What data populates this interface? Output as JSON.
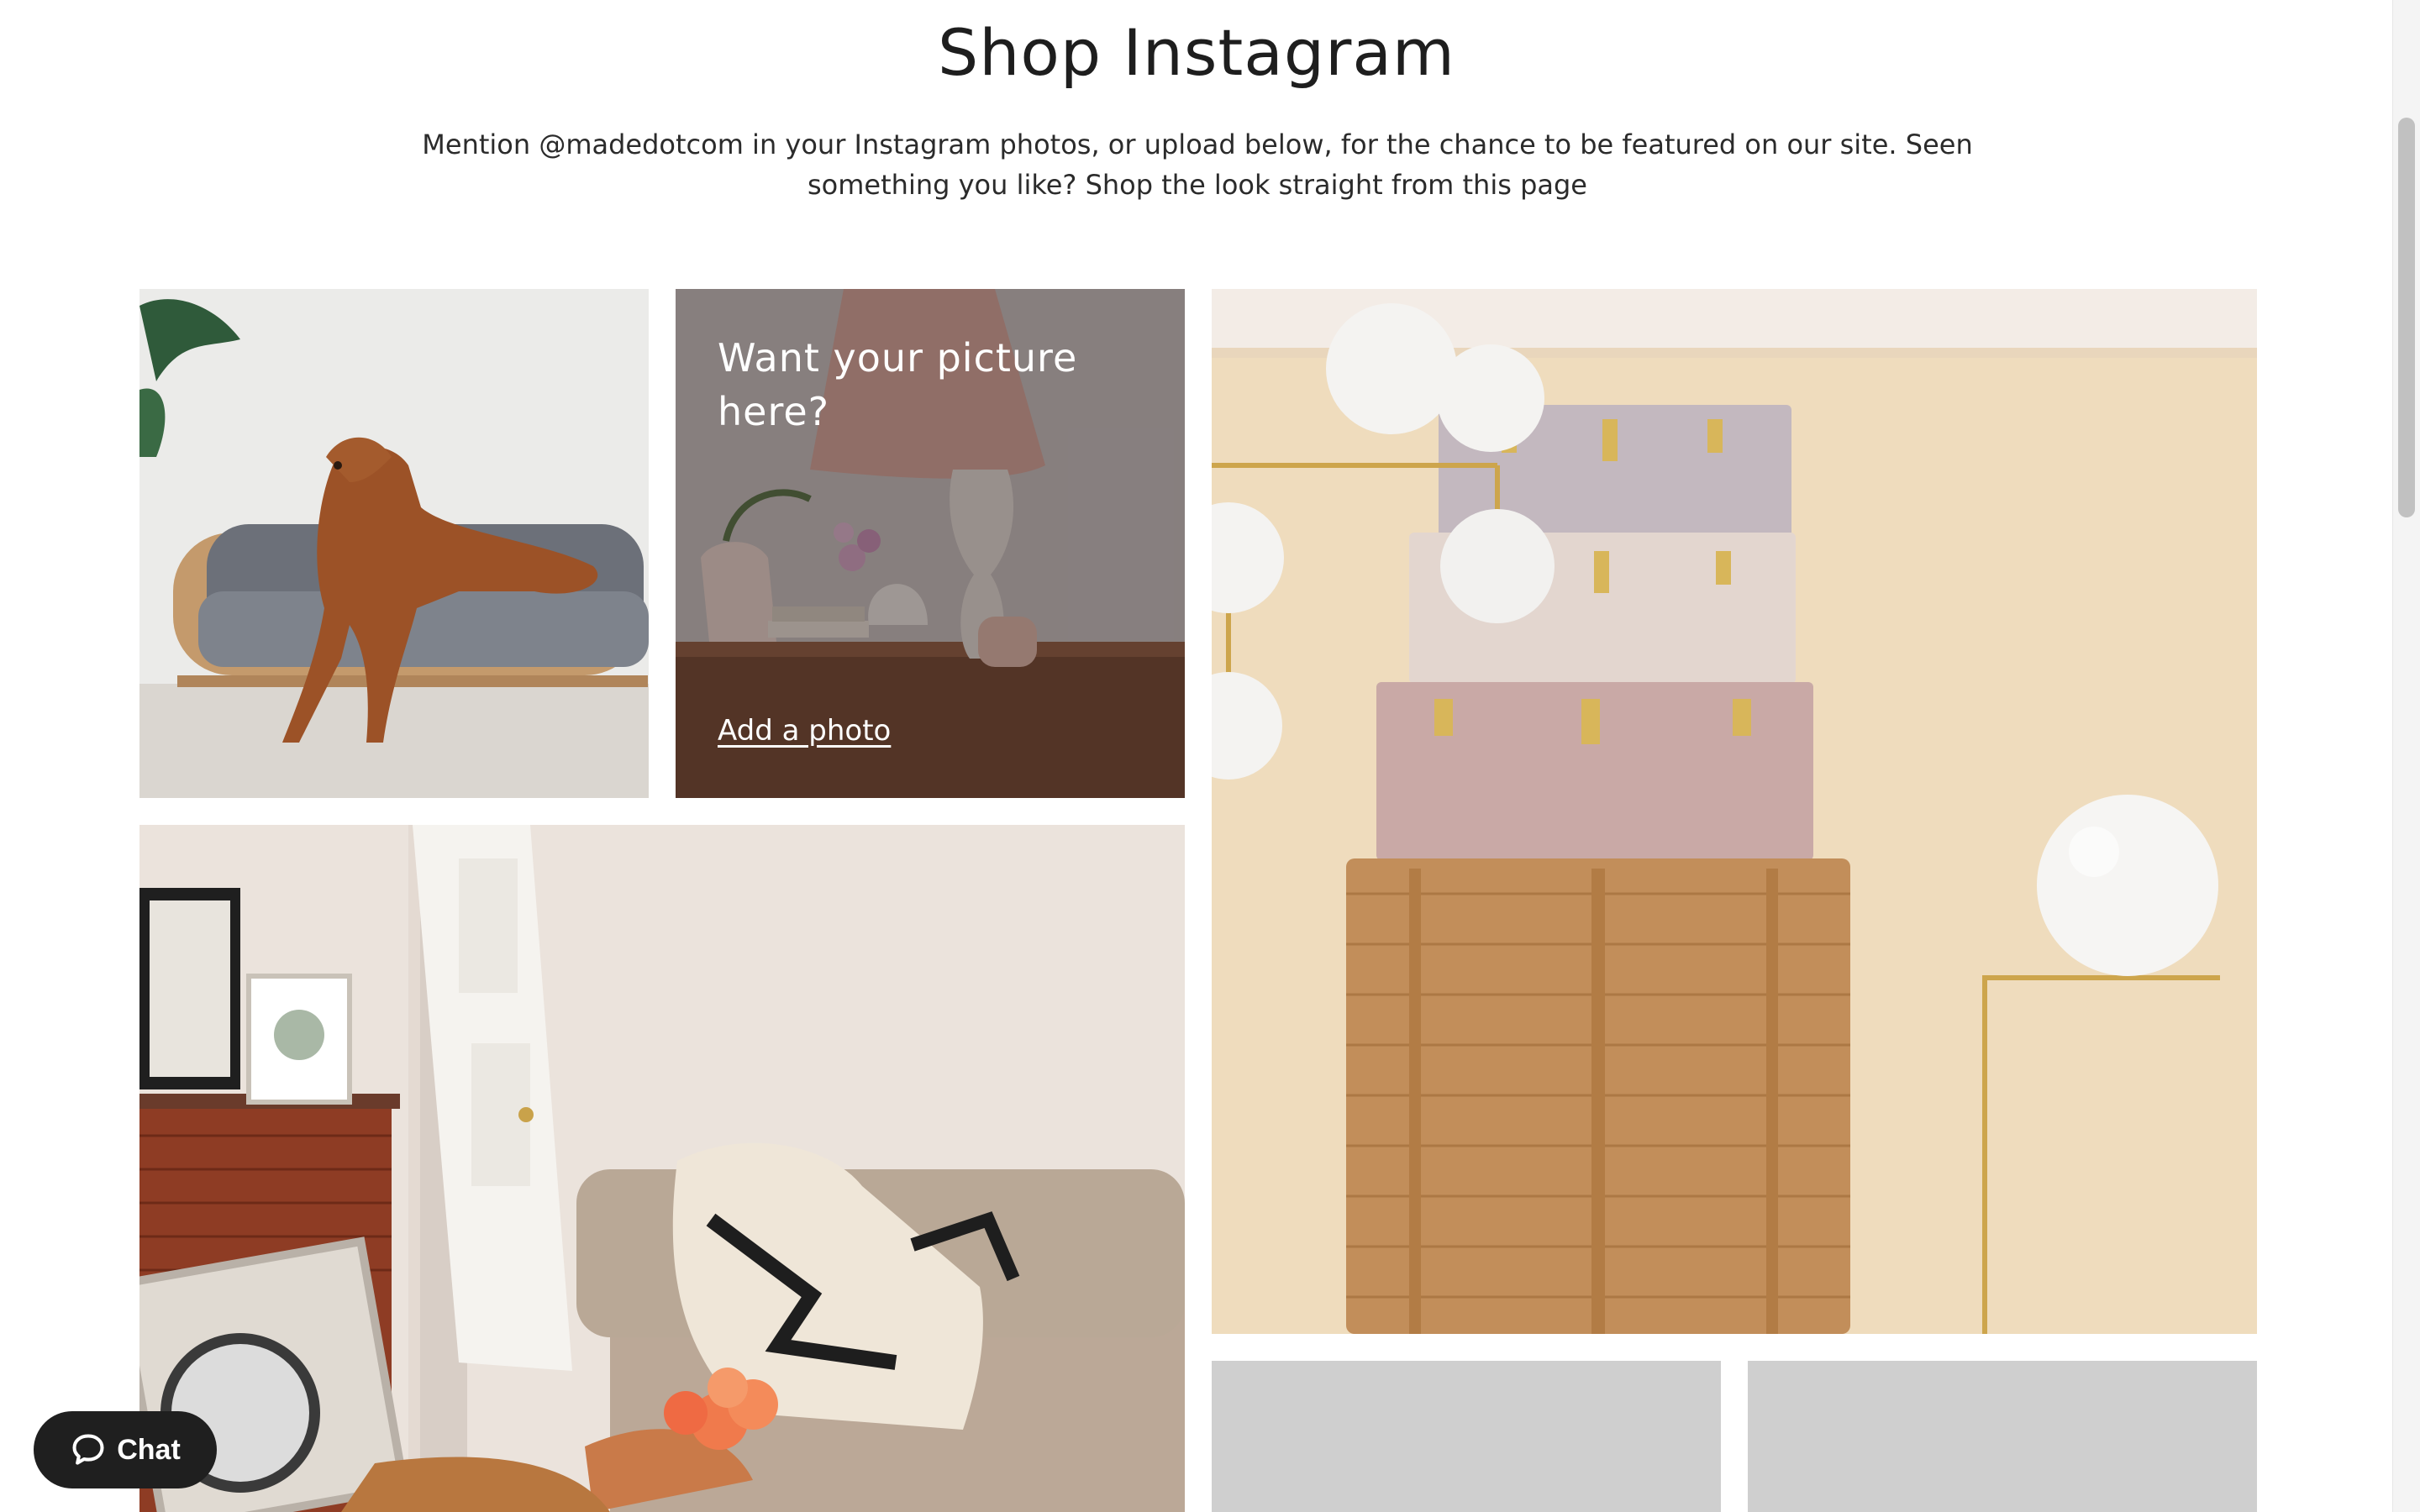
{
  "page": {
    "title": "Shop Instagram",
    "intro": "Mention @madedotcom in your Instagram photos, or upload below, for the chance to be featured on our site. Seen something you like? Shop the look straight from this page"
  },
  "gallery": {
    "upload_card": {
      "heading": "Want your picture here?",
      "link_label": "Add a photo"
    }
  },
  "chat": {
    "label": "Chat",
    "icon": "chat-bubble-icon"
  },
  "colors": {
    "placeholder": "#cfcfcf",
    "chat_background": "#1f1f1f"
  }
}
